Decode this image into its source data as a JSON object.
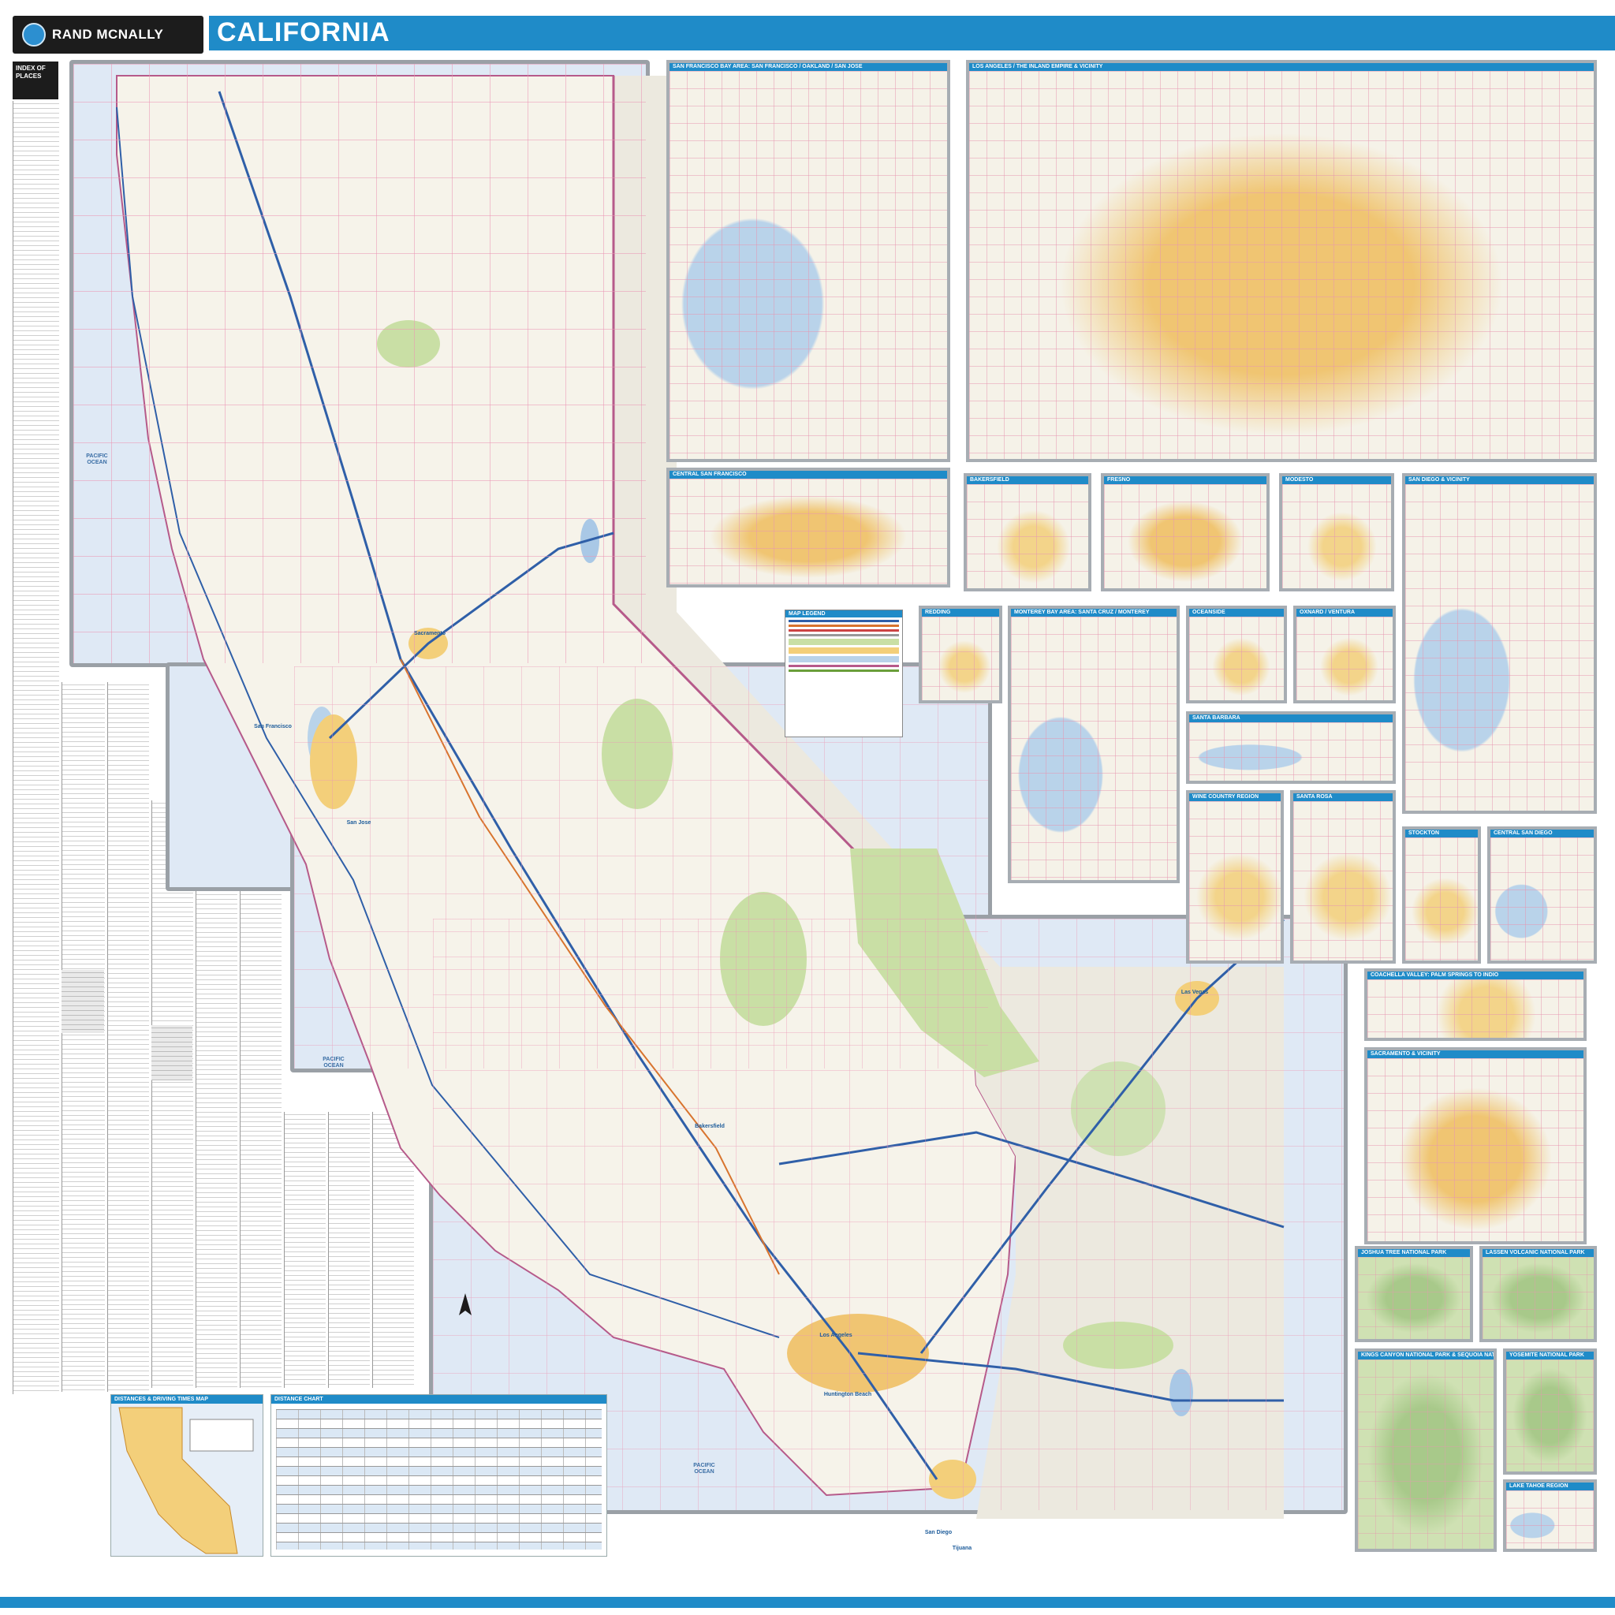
{
  "header": {
    "brand": "RAND MCNALLY",
    "state": "CALIFORNIA",
    "brand_color": "#1f8bc8"
  },
  "index": {
    "title": "INDEX OF PLACES"
  },
  "main_map": {
    "ocean_labels": [
      "PACIFIC OCEAN",
      "PACIFIC OCEAN",
      "PACIFIC OCEAN"
    ],
    "city_labels": [
      "San Francisco",
      "San Jose",
      "Sacramento",
      "Bakersfield",
      "Los Angeles",
      "Huntington Beach",
      "San Diego",
      "Tijuana",
      "Las Vegas"
    ]
  },
  "legend": {
    "title": "MAP LEGEND"
  },
  "insets": [
    {
      "title": "SAN FRANCISCO BAY AREA: SAN FRANCISCO / OAKLAND / SAN JOSE",
      "style": "bay"
    },
    {
      "title": "LOS ANGELES / THE INLAND EMPIRE & VICINITY",
      "style": "urbanbig"
    },
    {
      "title": "CENTRAL SAN FRANCISCO",
      "style": "urbanbig"
    },
    {
      "title": "BAKERSFIELD",
      "style": "plain"
    },
    {
      "title": "FRESNO",
      "style": "urbanbig"
    },
    {
      "title": "MODESTO",
      "style": "plain"
    },
    {
      "title": "SAN DIEGO & VICINITY",
      "style": "bay"
    },
    {
      "title": "REDDING",
      "style": "plain"
    },
    {
      "title": "MONTEREY BAY AREA: SANTA CRUZ / MONTEREY",
      "style": "bay"
    },
    {
      "title": "OCEANSIDE",
      "style": "plain"
    },
    {
      "title": "OXNARD / VENTURA",
      "style": "plain"
    },
    {
      "title": "SANTA BARBARA",
      "style": "plain"
    },
    {
      "title": "WINE COUNTRY REGION",
      "style": "plain"
    },
    {
      "title": "SANTA ROSA",
      "style": "plain"
    },
    {
      "title": "STOCKTON",
      "style": "plain"
    },
    {
      "title": "CENTRAL SAN DIEGO",
      "style": "bay"
    },
    {
      "title": "COACHELLA VALLEY: PALM SPRINGS TO INDIO",
      "style": "plain"
    },
    {
      "title": "SACRAMENTO & VICINITY",
      "style": "urbanbig"
    },
    {
      "title": "JOSHUA TREE NATIONAL PARK",
      "style": "green"
    },
    {
      "title": "LASSEN VOLCANIC NATIONAL PARK",
      "style": "green"
    },
    {
      "title": "KINGS CANYON NATIONAL PARK & SEQUOIA NATIONAL PARK",
      "style": "green"
    },
    {
      "title": "YOSEMITE NATIONAL PARK",
      "style": "green"
    },
    {
      "title": "LAKE TAHOE REGION",
      "style": "bay"
    }
  ],
  "distance_map": {
    "title": "DISTANCES & DRIVING TIMES MAP"
  },
  "distance_chart": {
    "title": "DISTANCE CHART"
  }
}
